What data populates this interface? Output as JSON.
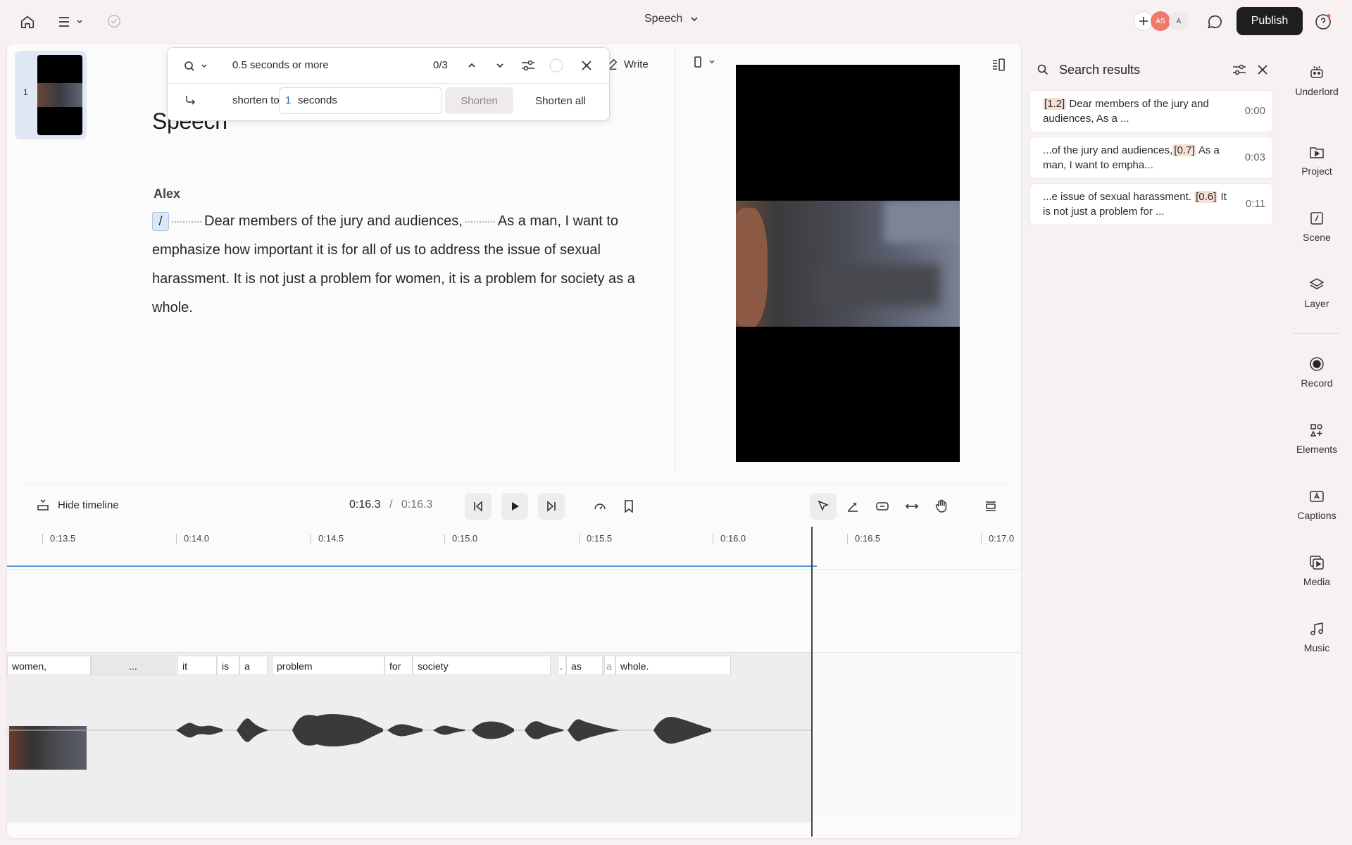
{
  "topbar": {
    "doc_title": "Speech",
    "avatars": [
      "AS",
      "A"
    ],
    "publish_label": "Publish"
  },
  "thumbnail": {
    "scene_number": "1"
  },
  "search": {
    "query": "0.5 seconds or more",
    "count": "0/3",
    "shorten_prefix": "shorten to",
    "shorten_value": "1",
    "shorten_unit": "seconds",
    "shorten_label": "Shorten",
    "shorten_all_label": "Shorten all"
  },
  "editor": {
    "write_label": "Write",
    "heading": "Speech",
    "speaker": "Alex",
    "pause_marker": "/",
    "sentence_1": "Dear members of the jury and audiences,",
    "sentence_2": "As a man, I want to emphasize how important it is for all of us to address the issue of sexual harassment. It is not just a problem for women, it is a problem for society as a whole."
  },
  "timeline": {
    "hide_label": "Hide timeline",
    "current_time": "0:16.3",
    "separator": "/",
    "total_time": "0:16.3",
    "ticks": [
      "0:13.5",
      "0:14.0",
      "0:14.5",
      "0:15.0",
      "0:15.5",
      "0:16.0",
      "0:16.5",
      "0:17.0"
    ],
    "words": [
      "women,",
      "...",
      "it",
      "is",
      "a",
      "problem",
      "for",
      "society",
      ".",
      "as",
      "a",
      "whole."
    ]
  },
  "results_panel": {
    "title": "Search results",
    "items": [
      {
        "tag": "[1.2]",
        "before": "",
        "after": " Dear members of the jury and audiences, As a ...",
        "time": "0:00"
      },
      {
        "tag": "[0.7]",
        "before": "...of the jury and audiences,",
        "after": " As a man, I want to empha...",
        "time": "0:03"
      },
      {
        "tag": "[0.6]",
        "before": "...e issue of sexual harassment. ",
        "after": " It is not just a problem for ...",
        "time": "0:11"
      }
    ]
  },
  "rail": {
    "items": [
      "Underlord",
      "Project",
      "Scene",
      "Layer",
      "Record",
      "Elements",
      "Captions",
      "Media",
      "Music"
    ]
  }
}
